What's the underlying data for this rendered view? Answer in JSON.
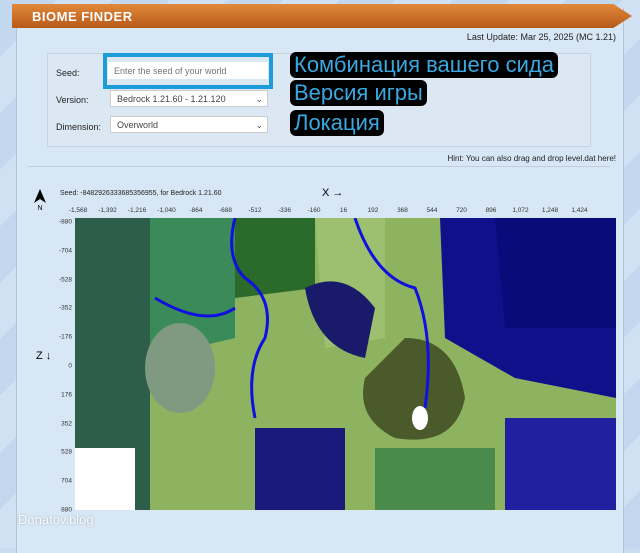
{
  "header": {
    "title": "BIOME FINDER",
    "last_update": "Last Update: Mar 25, 2025 (MC 1.21)"
  },
  "form": {
    "seed_label": "Seed:",
    "seed_placeholder": "Enter the seed of your world",
    "version_label": "Version:",
    "version_value": "Bedrock 1.21.60 - 1.21.120",
    "dimension_label": "Dimension:",
    "dimension_value": "Overworld"
  },
  "annotations": [
    "Комбинация вашего сида",
    "Версия игры",
    "Локация"
  ],
  "hint": "Hint: You can also drag and drop level.dat here!",
  "map": {
    "seed_info": "Seed: -8482926333685356955, for Bedrock 1.21.60",
    "x_axis": "X →",
    "z_axis": "Z ↓",
    "north": "N",
    "x_ticks": [
      "-1,568",
      "-1,392",
      "-1,216",
      "-1,040",
      "-864",
      "-688",
      "-512",
      "-336",
      "-160",
      "16",
      "192",
      "368",
      "544",
      "720",
      "896",
      "1,072",
      "1,248",
      "1,424"
    ],
    "z_ticks": [
      "-880",
      "-704",
      "-528",
      "-352",
      "-176",
      "0",
      "176",
      "352",
      "528",
      "704",
      "880"
    ]
  },
  "watermark": "Donatov.blog"
}
